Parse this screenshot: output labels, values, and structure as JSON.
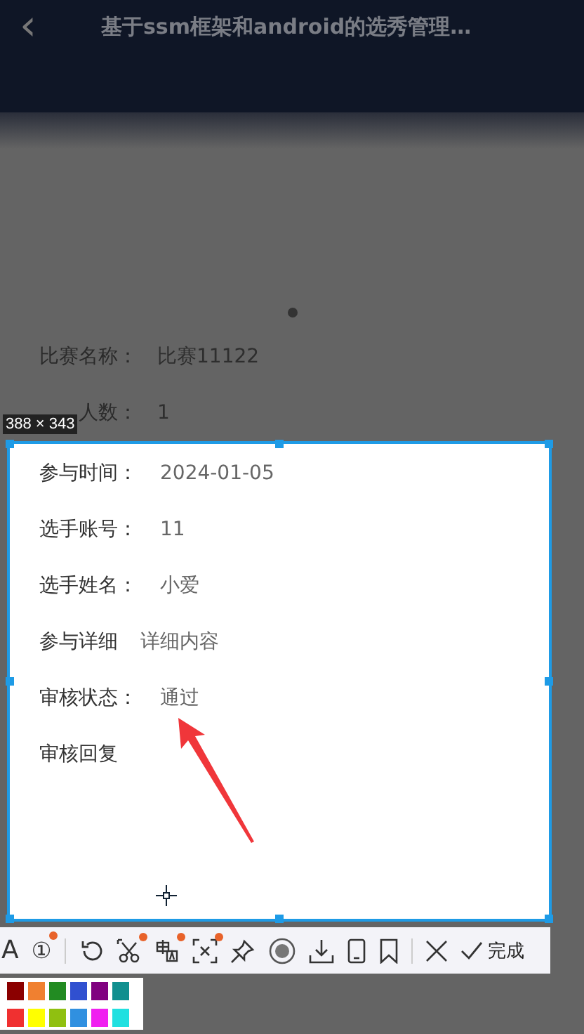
{
  "header": {
    "back": "‹",
    "title": "基于ssm框架和android的选秀管理…"
  },
  "dimmed_rows": [
    {
      "label": "比赛名称：",
      "value": "比赛11122"
    },
    {
      "label": "人数：",
      "value": "1"
    }
  ],
  "selection": {
    "size": "388 × 343"
  },
  "rows": [
    {
      "label": "参与时间：",
      "value": "2024-01-05"
    },
    {
      "label": "选手账号：",
      "value": "11"
    },
    {
      "label": "选手姓名：",
      "value": "小爱"
    },
    {
      "label": "参与详细",
      "value": "详细内容"
    },
    {
      "label": "审核状态：",
      "value": "通过"
    },
    {
      "label": "审核回复"
    }
  ],
  "toolbar": {
    "text_tool": "A",
    "number_tool": "①",
    "done": "完成"
  },
  "palette": [
    {
      "color": "#8b0000"
    },
    {
      "color": "#f08030"
    },
    {
      "color": "#228b22"
    },
    {
      "color": "#3050d0"
    },
    {
      "color": "#800080"
    },
    {
      "color": "#108f8f"
    },
    {
      "color": "#f03030"
    },
    {
      "color": "#ffff00"
    },
    {
      "color": "#90c010"
    },
    {
      "color": "#3090e0"
    },
    {
      "color": "#f020f0"
    },
    {
      "color": "#20e0e0"
    }
  ]
}
